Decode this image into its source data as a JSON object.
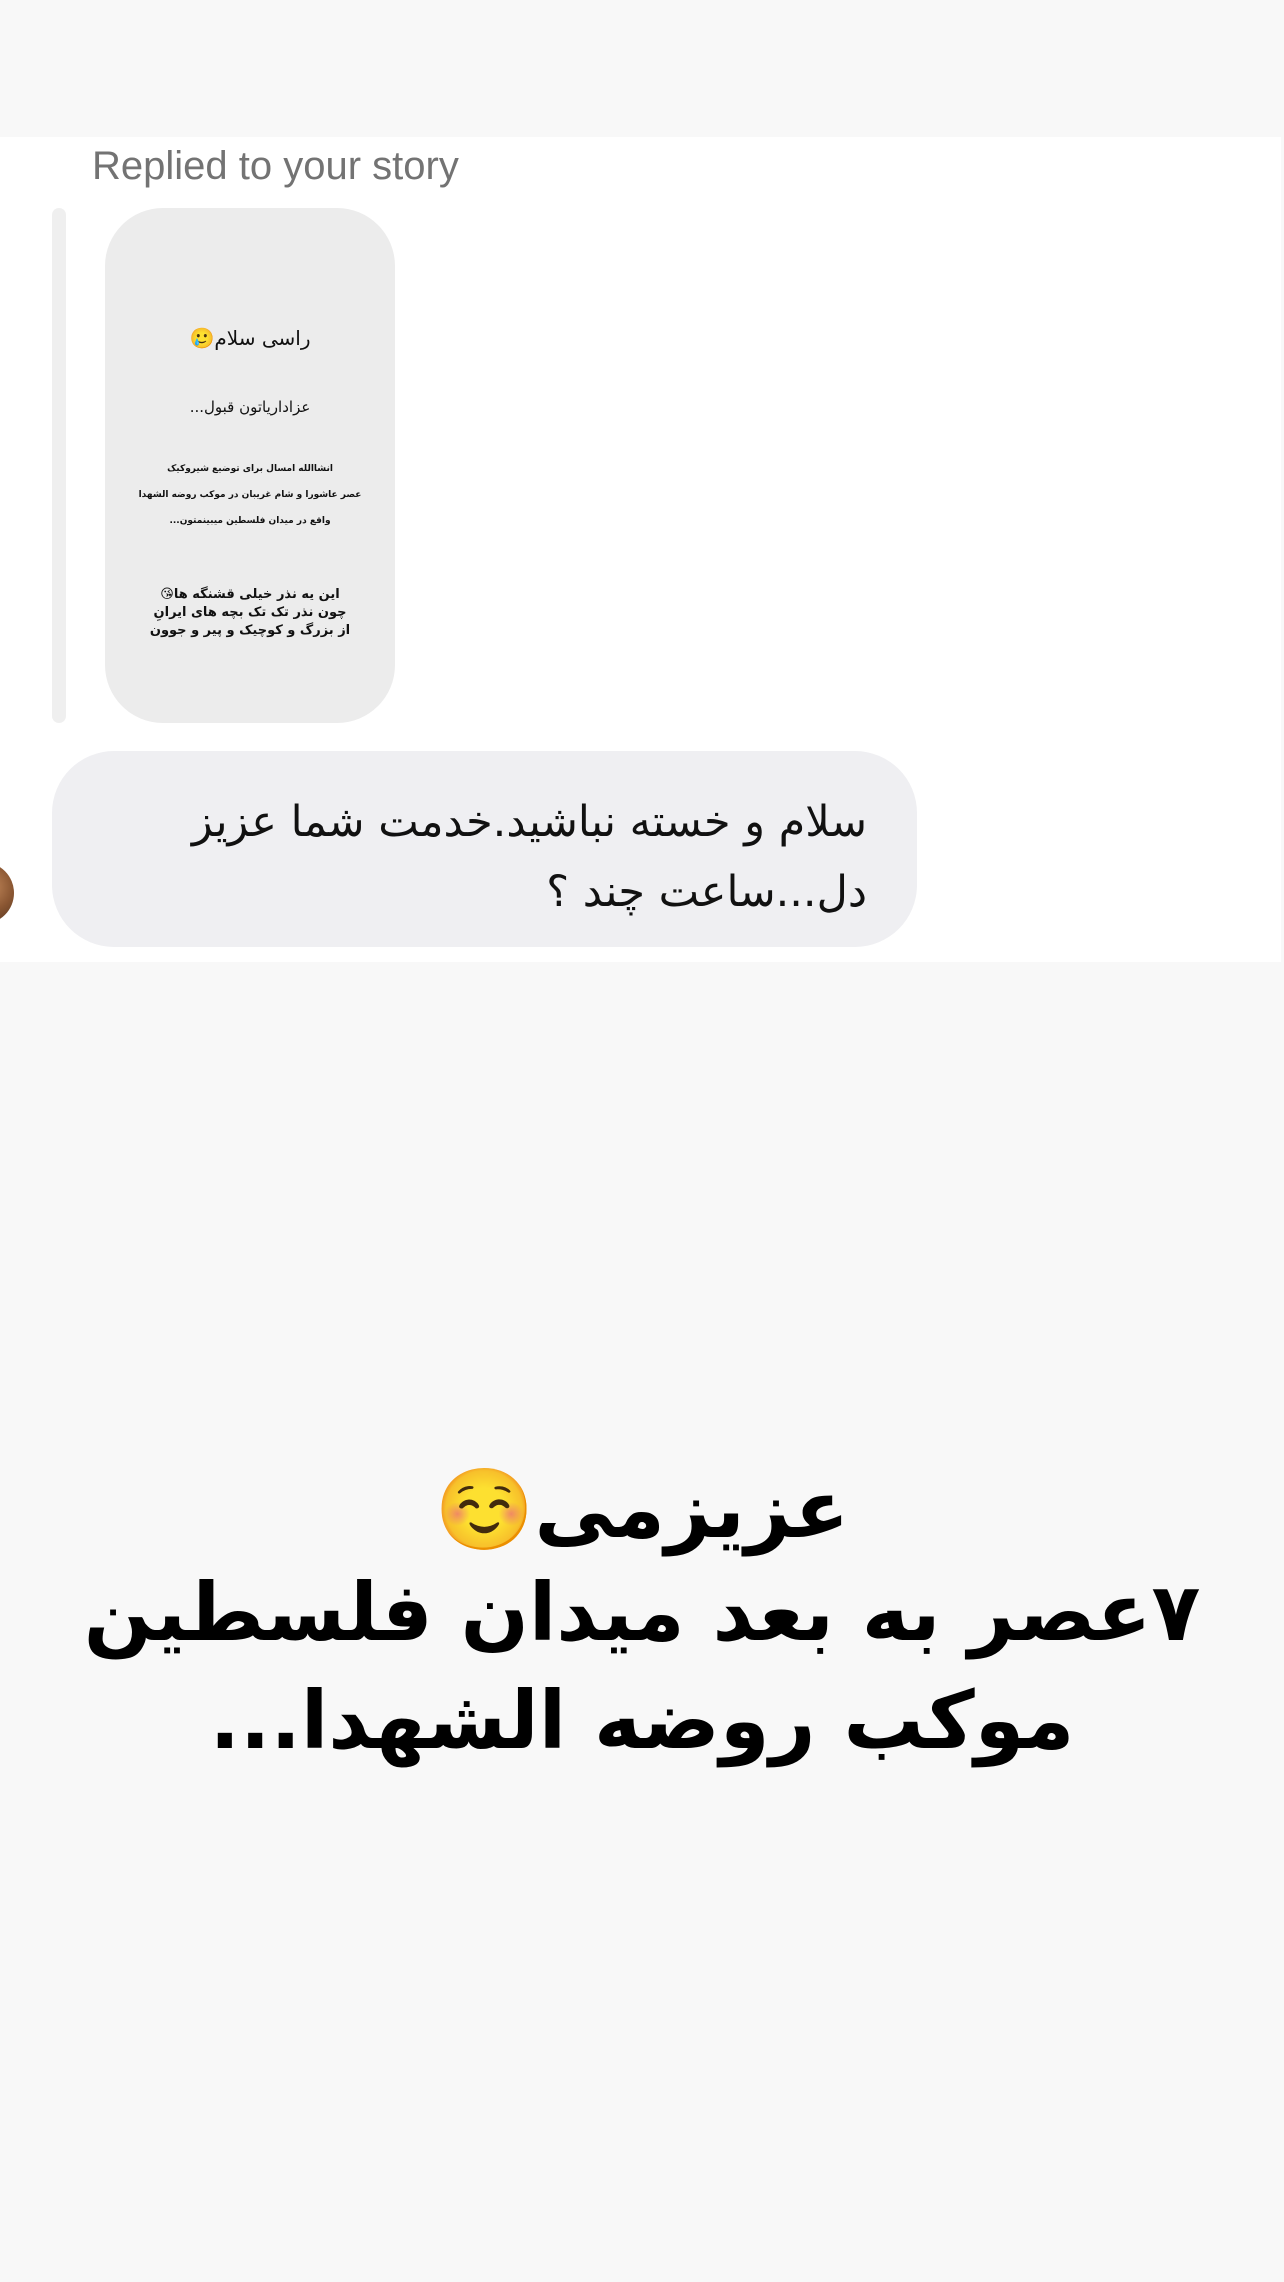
{
  "reply": {
    "caption": "Replied to your story"
  },
  "story_preview": {
    "line1": "راسی سلام🥲",
    "line2": "عزاداریاتون قبول...",
    "line3": "انشاالله امسال برای توضیع شیروکیک",
    "line4": "عصر عاشورا و شام غریبان در موکب روضه الشهدا",
    "line5": "واقع در میدان فلسطین میبینمتون...",
    "line6": "این یه نذر خیلی قشنگه ها😘",
    "line7": "چون نذر تک تک  بچه های ایرانِ",
    "line8": "از بزرگ و کوچیک و پیر و جوون"
  },
  "message": {
    "text": "سلام و خسته نباشید.خدمت شما عزیز دل...ساعت چند ؟"
  },
  "story_reply": {
    "line1": "عزیزمی☺️",
    "line2": "۷عصر به بعد میدان فلسطین",
    "line3": "موکب روضه الشهدا..."
  }
}
